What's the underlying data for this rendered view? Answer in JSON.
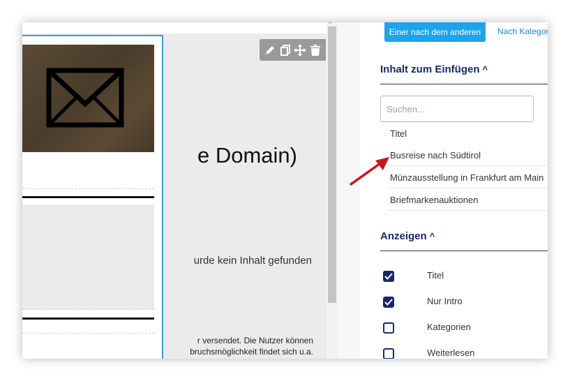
{
  "canvas": {
    "heading_text": "e Domain)",
    "notice_text": "urde kein Inhalt gefunden",
    "body_line_1": "r versendet. Die Nutzer können",
    "body_line_2": "bruchsmöglichkeit findet sich u.a."
  },
  "block_toolbar": {
    "icons": [
      "pencil-icon",
      "copy-icon",
      "move-icon",
      "trash-icon"
    ]
  },
  "panel": {
    "mode_tabs": {
      "one_by_one": "Einer nach dem anderen",
      "by_category": "Nach Kategor"
    },
    "insert_section": {
      "title": "Inhalt zum Einfügen",
      "caret": "^",
      "search_placeholder": "Suchen...",
      "items": [
        "Titel",
        "Busreise nach Südtirol",
        "Münzausstellung in Frankfurt am Main",
        "Briefmarkenauktionen"
      ]
    },
    "display_section": {
      "title": "Anzeigen",
      "caret": "^",
      "options": [
        {
          "label": "Titel",
          "checked": true
        },
        {
          "label": "Nur Intro",
          "checked": true
        },
        {
          "label": "Kategorien",
          "checked": false
        },
        {
          "label": "Weiterlesen",
          "checked": false
        }
      ],
      "second_column_checked": [
        true,
        false,
        false
      ]
    }
  },
  "colors": {
    "accent_blue": "#1ea4ea",
    "selection_border": "#3a9ad9",
    "navy": "#1b2866",
    "annotation_arrow": "#c8161d"
  }
}
